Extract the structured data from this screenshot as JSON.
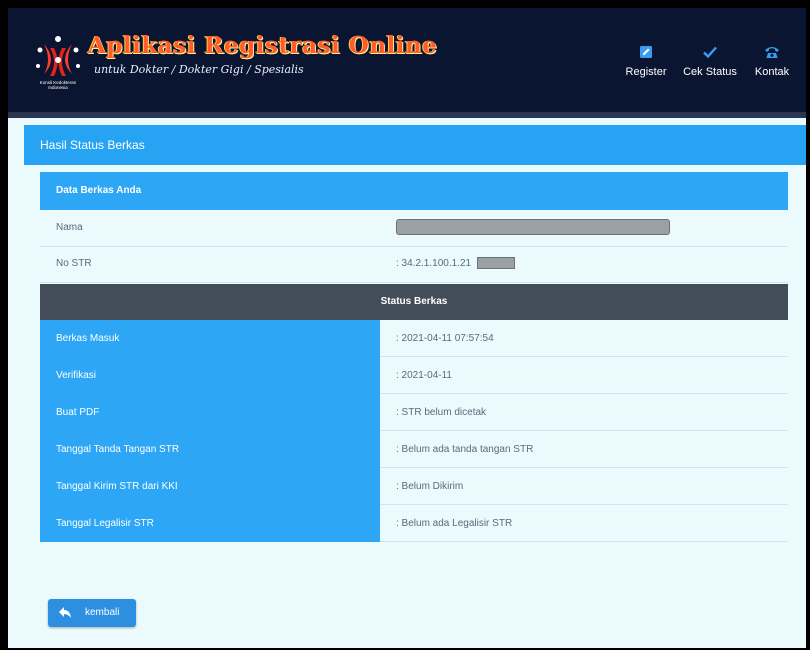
{
  "header": {
    "title": "Aplikasi Registrasi Online",
    "subtitle": "untuk Dokter / Dokter Gigi / Spesialis",
    "logo_icon": "kki-logo-icon",
    "logo_text_line1": "Konsil Kedokteran",
    "logo_text_line2": "Indonesia",
    "nav": [
      {
        "label": "Register",
        "icon": "edit-icon"
      },
      {
        "label": "Cek Status",
        "icon": "check-icon"
      },
      {
        "label": "Kontak",
        "icon": "phone-icon"
      }
    ],
    "colors": {
      "background": "#0a1631",
      "title": "#ff5b2b"
    }
  },
  "panel": {
    "heading": "Hasil Status Berkas",
    "accent_color": "#27a3f4"
  },
  "data_berkas": {
    "heading": "Data Berkas Anda",
    "rows": [
      {
        "label": "Nama",
        "value": ""
      },
      {
        "label": "No STR",
        "value": ": 34.2.1.100.1.21"
      }
    ]
  },
  "status_berkas": {
    "heading": "Status Berkas",
    "rows": [
      {
        "label": "Berkas Masuk",
        "value": ": 2021-04-11 07:57:54"
      },
      {
        "label": "Verifikasi",
        "value": ": 2021-04-11"
      },
      {
        "label": "Buat PDF",
        "value": ": STR belum dicetak"
      },
      {
        "label": "Tanggal Tanda Tangan STR",
        "value": ": Belum ada tanda tangan STR"
      },
      {
        "label": "Tanggal Kirim STR dari KKI",
        "value": ": Belum Dikirim"
      },
      {
        "label": "Tanggal Legalisir STR",
        "value": ": Belum ada Legalisir STR"
      }
    ]
  },
  "back_button": {
    "label": "kembali",
    "icon": "reply-arrow-icon"
  }
}
